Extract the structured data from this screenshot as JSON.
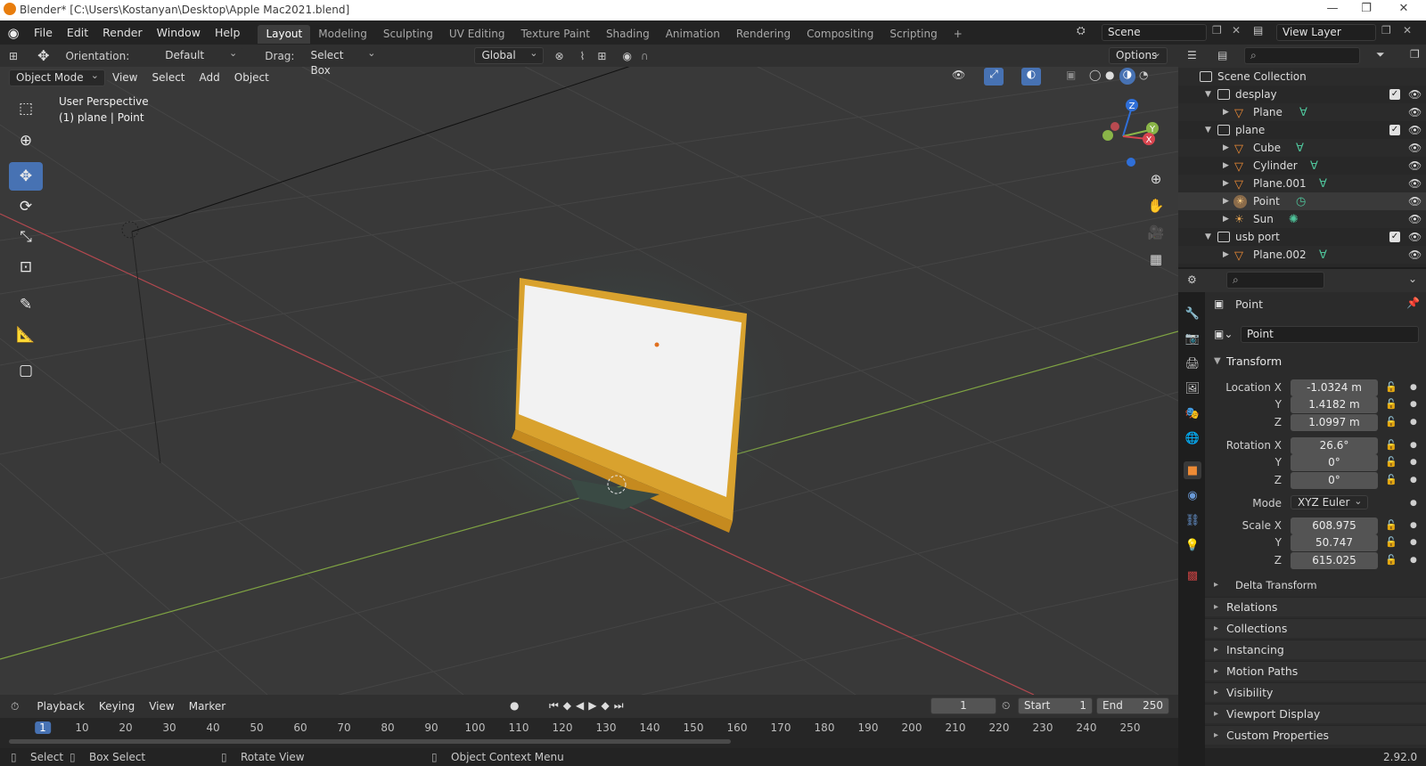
{
  "window": {
    "title": "Blender* [C:\\Users\\Kostanyan\\Desktop\\Apple Mac2021.blend]",
    "minimize": "—",
    "maximize": "❐",
    "close": "✕"
  },
  "menu": {
    "items": [
      "File",
      "Edit",
      "Render",
      "Window",
      "Help"
    ]
  },
  "workspaces": [
    "Layout",
    "Modeling",
    "Sculpting",
    "UV Editing",
    "Texture Paint",
    "Shading",
    "Animation",
    "Rendering",
    "Compositing",
    "Scripting"
  ],
  "workspace_add": "+",
  "scene": {
    "name": "Scene",
    "view_layer": "View Layer"
  },
  "toolheader": {
    "orientation_label": "Orientation:",
    "orientation_value": "Default",
    "drag_label": "Drag:",
    "drag_value": "Select Box",
    "transform_orientation": "Global",
    "options": "Options"
  },
  "viewport_header": {
    "mode": "Object Mode",
    "menus": [
      "View",
      "Select",
      "Add",
      "Object"
    ]
  },
  "viewport": {
    "perspective": "User Perspective",
    "context": "(1) plane | Point"
  },
  "gizmo": {
    "z": "Z",
    "y": "Y",
    "x": "X"
  },
  "timeline": {
    "menus": [
      "Playback",
      "Keying",
      "View",
      "Marker"
    ],
    "current_frame": "1",
    "start_label": "Start",
    "start": "1",
    "end_label": "End",
    "end": "250",
    "ticks": [
      "1",
      "10",
      "20",
      "30",
      "40",
      "50",
      "60",
      "70",
      "80",
      "90",
      "100",
      "110",
      "120",
      "130",
      "140",
      "150",
      "160",
      "170",
      "180",
      "190",
      "200",
      "210",
      "220",
      "230",
      "240",
      "250"
    ]
  },
  "status": {
    "select": "Select",
    "box_select": "Box Select",
    "rotate_view": "Rotate View",
    "context_menu": "Object Context Menu",
    "version": "2.92.0"
  },
  "outliner": {
    "root": "Scene Collection",
    "rows": [
      {
        "name": "desplay",
        "kind": "collection",
        "indent": 1,
        "open": true
      },
      {
        "name": "Plane",
        "kind": "mesh",
        "indent": 2
      },
      {
        "name": "plane",
        "kind": "collection",
        "indent": 1,
        "open": true
      },
      {
        "name": "Cube",
        "kind": "mesh",
        "indent": 2
      },
      {
        "name": "Cylinder",
        "kind": "mesh",
        "indent": 2
      },
      {
        "name": "Plane.001",
        "kind": "mesh",
        "indent": 2
      },
      {
        "name": "Point",
        "kind": "light",
        "indent": 2
      },
      {
        "name": "Sun",
        "kind": "light",
        "indent": 2
      },
      {
        "name": "usb port",
        "kind": "collection",
        "indent": 1,
        "open": true
      },
      {
        "name": "Plane.002",
        "kind": "mesh",
        "indent": 2
      }
    ]
  },
  "properties": {
    "object_name": "Point",
    "data_name": "Point",
    "transform_title": "Transform",
    "location": {
      "label": "Location X",
      "x": "-1.0324 m",
      "y": "1.4182 m",
      "z": "1.0997 m"
    },
    "rotation": {
      "label": "Rotation X",
      "x": "26.6°",
      "y": "0°",
      "z": "0°"
    },
    "mode": {
      "label": "Mode",
      "value": "XYZ Euler"
    },
    "scale": {
      "label": "Scale X",
      "x": "608.975",
      "y": "50.747",
      "z": "615.025"
    },
    "axis_y": "Y",
    "axis_z": "Z",
    "delta": "Delta Transform",
    "panels": [
      "Relations",
      "Collections",
      "Instancing",
      "Motion Paths",
      "Visibility",
      "Viewport Display",
      "Custom Properties"
    ]
  },
  "colors": {
    "accent": "#4772b3",
    "orange": "#e87d0d",
    "data_green": "#4fc49b",
    "x_axis": "#d9454f",
    "y_axis": "#8ab548",
    "z_axis": "#2f6fd8"
  }
}
